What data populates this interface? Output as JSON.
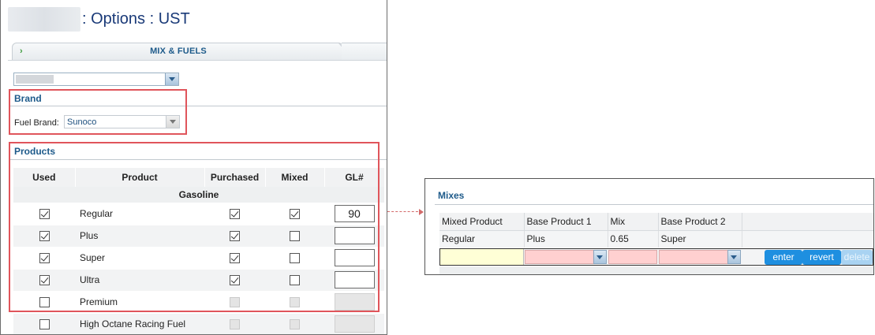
{
  "header": {
    "title": ": Options : UST"
  },
  "tab": {
    "label": "MIX & FUELS",
    "arrow": "›"
  },
  "brand": {
    "section_title": "Brand",
    "fuel_brand_label": "Fuel Brand:",
    "fuel_brand_value": "Sunoco"
  },
  "products": {
    "section_title": "Products",
    "columns": [
      "Used",
      "Product",
      "Purchased",
      "Mixed",
      "GL#"
    ],
    "group_label": "Gasoline",
    "rows": [
      {
        "name": "Regular",
        "used": true,
        "purchased": true,
        "mixed": true,
        "gl": "90",
        "enabled": true
      },
      {
        "name": "Plus",
        "used": true,
        "purchased": true,
        "mixed": false,
        "gl": "",
        "enabled": true
      },
      {
        "name": "Super",
        "used": true,
        "purchased": true,
        "mixed": false,
        "gl": "",
        "enabled": true
      },
      {
        "name": "Ultra",
        "used": true,
        "purchased": true,
        "mixed": false,
        "gl": "",
        "enabled": true
      },
      {
        "name": "Premium",
        "used": false,
        "purchased": false,
        "mixed": false,
        "gl": "",
        "enabled": false
      },
      {
        "name": "High Octane Racing Fuel",
        "used": false,
        "purchased": false,
        "mixed": false,
        "gl": "",
        "enabled": false
      }
    ]
  },
  "mixes": {
    "section_title": "Mixes",
    "columns": [
      "Mixed Product",
      "Base Product 1",
      "Mix",
      "Base Product 2",
      ""
    ],
    "rows": [
      {
        "mixed_product": "Regular",
        "base_product_1": "Plus",
        "mix": "0.65",
        "base_product_2": "Super"
      }
    ],
    "buttons": {
      "enter": "enter",
      "revert": "revert",
      "delete": "delete"
    }
  },
  "colors": {
    "accent": "#1d5a8a",
    "highlight_border": "#e0555b",
    "button": "#1e8fe0",
    "invalid_field": "#ffd0d0",
    "new_field": "#ffffd6"
  }
}
